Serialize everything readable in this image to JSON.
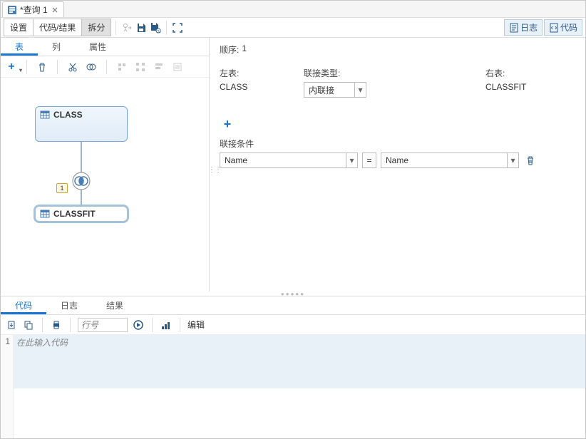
{
  "tab": {
    "title": "*查询 1"
  },
  "toolbar": {
    "settings": "设置",
    "code_result": "代码/结果",
    "split": "拆分",
    "log_btn": "日志",
    "code_btn": "代码"
  },
  "subtabs": {
    "table": "表",
    "column": "列",
    "attr": "属性"
  },
  "diagram": {
    "table1": "CLASS",
    "table2": "CLASSFIT",
    "join_badge": "1"
  },
  "right": {
    "order_lbl": "顺序:",
    "order_val": "1",
    "left_table_lbl": "左表:",
    "join_type_lbl": "联接类型:",
    "right_table_lbl": "右表:",
    "left_table_val": "CLASS",
    "join_type_val": "内联接",
    "right_table_val": "CLASSFIT",
    "cond_title": "联接条件",
    "cond_left": "Name",
    "cond_op": "=",
    "cond_right": "Name"
  },
  "lower_tabs": {
    "code": "代码",
    "log": "日志",
    "result": "结果"
  },
  "code_toolbar": {
    "line_placeholder": "行号",
    "edit": "编辑"
  },
  "code": {
    "line_no": "1",
    "placeholder": "在此输入代码"
  }
}
